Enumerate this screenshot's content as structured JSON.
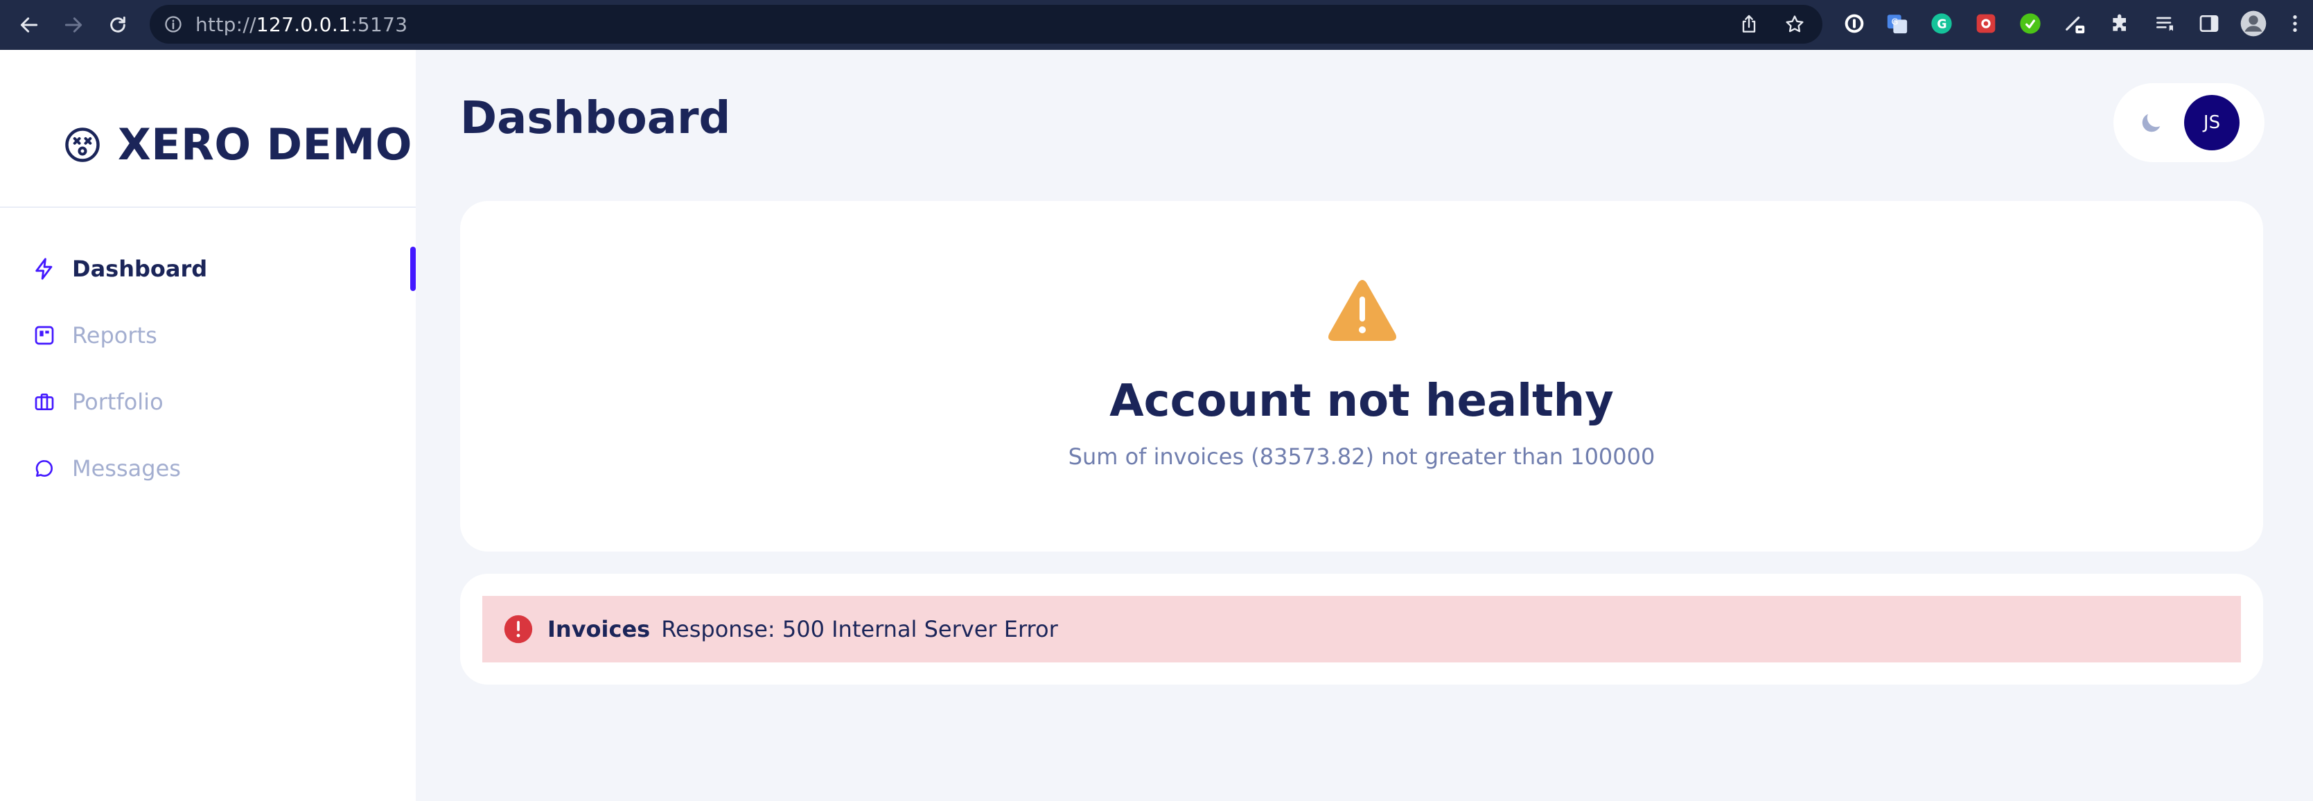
{
  "browser": {
    "url_scheme": "http://",
    "url_host": "127.0.0.1",
    "url_port": ":5173",
    "icons": [
      "back-arrow-icon",
      "forward-arrow-icon",
      "reload-icon",
      "info-icon",
      "share-icon",
      "star-icon"
    ],
    "extensions": [
      "1password-icon",
      "google-translate-icon",
      "grammarly-icon",
      "extension-red-icon",
      "extension-green-icon",
      "pen-extension-icon",
      "puzzle-icon",
      "reading-list-icon",
      "side-panel-icon",
      "profile-avatar-icon",
      "more-menu-icon"
    ]
  },
  "sidebar": {
    "logo": {
      "icon": "dizzy-face-icon",
      "text": "XERO DEMO"
    },
    "items": [
      {
        "label": "Dashboard",
        "icon": "lightning-icon",
        "active": true
      },
      {
        "label": "Reports",
        "icon": "report-board-icon",
        "active": false
      },
      {
        "label": "Portfolio",
        "icon": "briefcase-icon",
        "active": false
      },
      {
        "label": "Messages",
        "icon": "chat-bubble-icon",
        "active": false
      }
    ]
  },
  "header": {
    "title": "Dashboard",
    "theme_toggle_icon": "moon-icon",
    "avatar_initials": "JS"
  },
  "health": {
    "icon": "warning-triangle-icon",
    "title": "Account not healthy",
    "subtitle": "Sum of invoices (83573.82) not greater than 100000"
  },
  "error_alert": {
    "icon": "exclamation-circle-icon",
    "title": "Invoices",
    "message": "Response: 500 Internal Server Error"
  },
  "colors": {
    "accent": "#4318FF",
    "text_primary": "#1B2559",
    "text_secondary": "#A3AED0",
    "warning": "#F0A94B",
    "error": "#D9363E",
    "error_bg": "#F8D7DA",
    "avatar_bg": "#11047A",
    "background": "#F3F5FA"
  }
}
